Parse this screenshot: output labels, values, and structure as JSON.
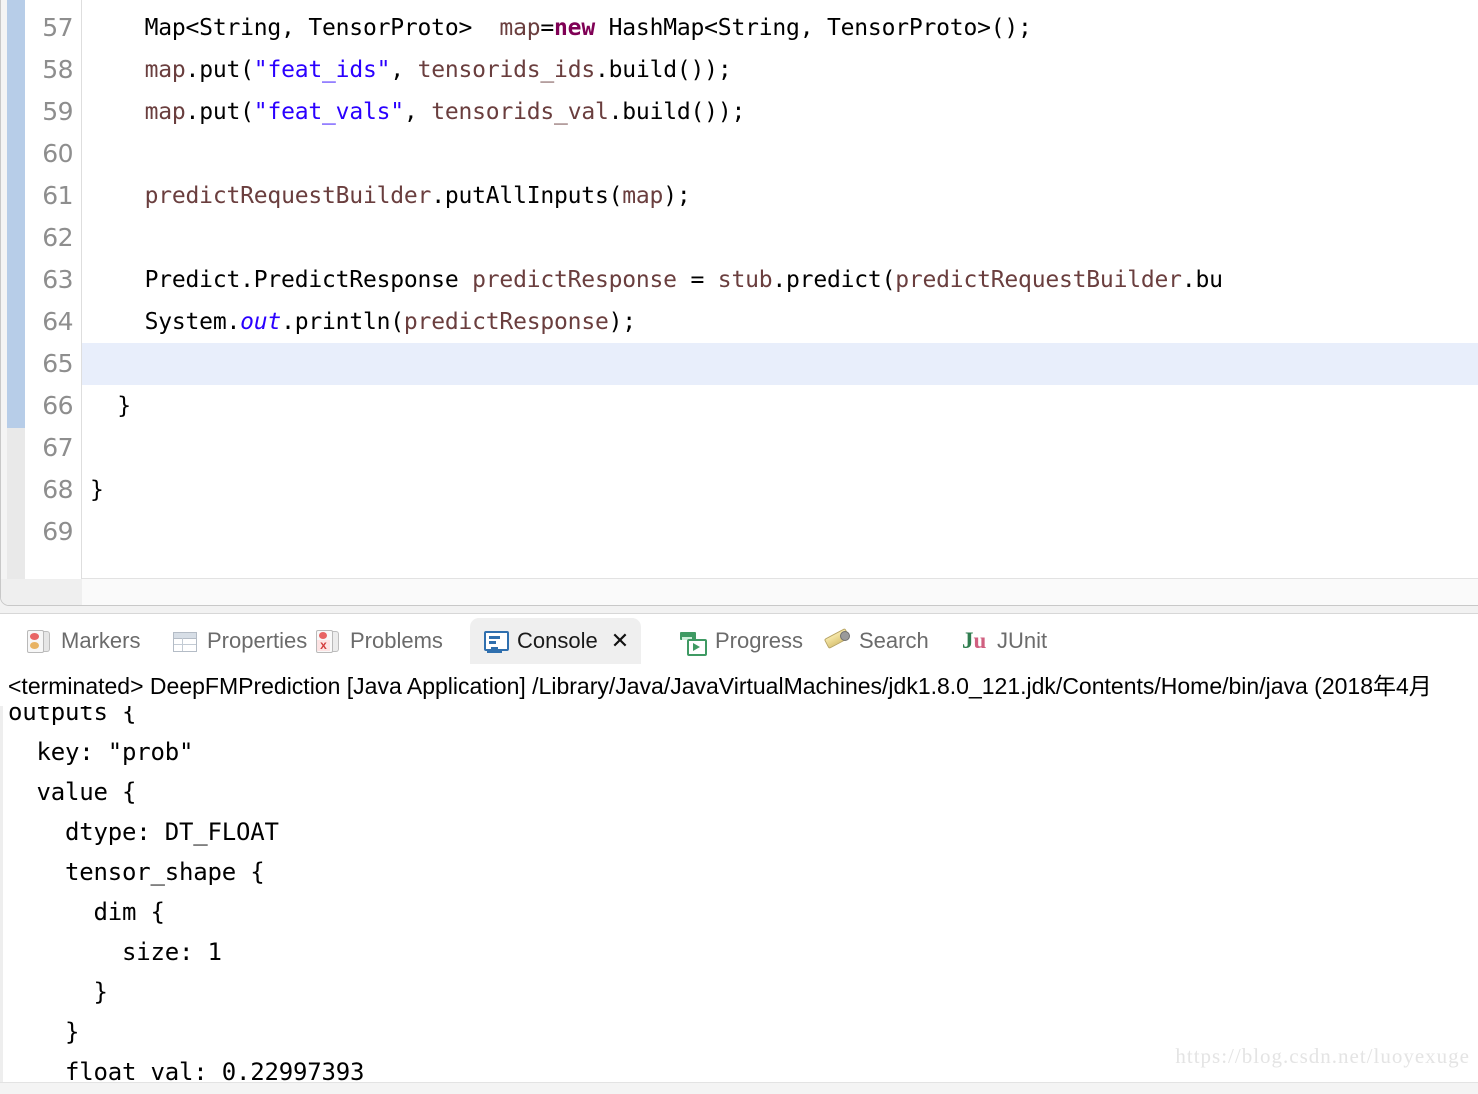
{
  "editor": {
    "first_partial_line": "56",
    "current_line_highlight": "65",
    "lines": [
      {
        "no": "57",
        "tokens": [
          {
            "t": "    Map<String, TensorProto>  ",
            "c": "pln"
          },
          {
            "t": "map",
            "c": "var"
          },
          {
            "t": "=",
            "c": "pln"
          },
          {
            "t": "new",
            "c": "kw"
          },
          {
            "t": " HashMap<String, TensorProto>();",
            "c": "pln"
          }
        ]
      },
      {
        "no": "58",
        "tokens": [
          {
            "t": "    ",
            "c": "pln"
          },
          {
            "t": "map",
            "c": "var"
          },
          {
            "t": ".put(",
            "c": "pln"
          },
          {
            "t": "\"feat_ids\"",
            "c": "str"
          },
          {
            "t": ", ",
            "c": "pln"
          },
          {
            "t": "tensorids_ids",
            "c": "var"
          },
          {
            "t": ".build());",
            "c": "pln"
          }
        ]
      },
      {
        "no": "59",
        "tokens": [
          {
            "t": "    ",
            "c": "pln"
          },
          {
            "t": "map",
            "c": "var"
          },
          {
            "t": ".put(",
            "c": "pln"
          },
          {
            "t": "\"feat_vals\"",
            "c": "str"
          },
          {
            "t": ", ",
            "c": "pln"
          },
          {
            "t": "tensorids_val",
            "c": "var"
          },
          {
            "t": ".build());",
            "c": "pln"
          }
        ]
      },
      {
        "no": "60",
        "tokens": []
      },
      {
        "no": "61",
        "tokens": [
          {
            "t": "    ",
            "c": "pln"
          },
          {
            "t": "predictRequestBuilder",
            "c": "var"
          },
          {
            "t": ".putAllInputs(",
            "c": "pln"
          },
          {
            "t": "map",
            "c": "var"
          },
          {
            "t": ");",
            "c": "pln"
          }
        ]
      },
      {
        "no": "62",
        "tokens": []
      },
      {
        "no": "63",
        "tokens": [
          {
            "t": "    Predict.PredictResponse ",
            "c": "pln"
          },
          {
            "t": "predictResponse",
            "c": "var"
          },
          {
            "t": " = ",
            "c": "pln"
          },
          {
            "t": "stub",
            "c": "var"
          },
          {
            "t": ".predict(",
            "c": "pln"
          },
          {
            "t": "predictRequestBuilder",
            "c": "var"
          },
          {
            "t": ".bu",
            "c": "pln"
          }
        ]
      },
      {
        "no": "64",
        "tokens": [
          {
            "t": "    System.",
            "c": "pln"
          },
          {
            "t": "out",
            "c": "stat"
          },
          {
            "t": ".println(",
            "c": "pln"
          },
          {
            "t": "predictResponse",
            "c": "var"
          },
          {
            "t": ");",
            "c": "pln"
          }
        ]
      },
      {
        "no": "65",
        "tokens": []
      },
      {
        "no": "66",
        "tokens": [
          {
            "t": "  }",
            "c": "pln"
          }
        ]
      },
      {
        "no": "67",
        "tokens": []
      },
      {
        "no": "68",
        "tokens": [
          {
            "t": "}",
            "c": "pln"
          }
        ]
      },
      {
        "no": "69",
        "tokens": []
      }
    ]
  },
  "bottom_view": {
    "tabs": [
      {
        "label": "Markers",
        "icon": "markers-icon",
        "active": false,
        "closable": false
      },
      {
        "label": "Properties",
        "icon": "properties-icon",
        "active": false,
        "closable": false
      },
      {
        "label": "Problems",
        "icon": "problems-icon",
        "active": false,
        "closable": false
      },
      {
        "label": "Console",
        "icon": "console-icon",
        "active": true,
        "closable": true
      },
      {
        "label": "Progress",
        "icon": "progress-icon",
        "active": false,
        "closable": false
      },
      {
        "label": "Search",
        "icon": "search-icon",
        "active": false,
        "closable": false
      },
      {
        "label": "JUnit",
        "icon": "junit-icon",
        "active": false,
        "closable": false
      }
    ],
    "close_glyph": "✕",
    "launch_line": "<terminated> DeepFMPrediction [Java Application] /Library/Java/JavaVirtualMachines/jdk1.8.0_121.jdk/Contents/Home/bin/java (2018年4月",
    "console_output": [
      "outputs {",
      "  key: \"prob\"",
      "  value {",
      "    dtype: DT_FLOAT",
      "    tensor_shape {",
      "      dim {",
      "        size: 1",
      "      }",
      "    }",
      "    float_val: 0.22997393"
    ]
  },
  "watermark": "https://blog.csdn.net/luoyexuge",
  "colors": {
    "keyword": "#7F0055",
    "string": "#2A00FF",
    "local_variable": "#6A3E3E",
    "static_field": "#2A00FF",
    "plain": "#000000",
    "change_bar": "#B7CDE8",
    "current_line": "#E8EEFB",
    "active_tab_bg": "#EFEFEF"
  }
}
